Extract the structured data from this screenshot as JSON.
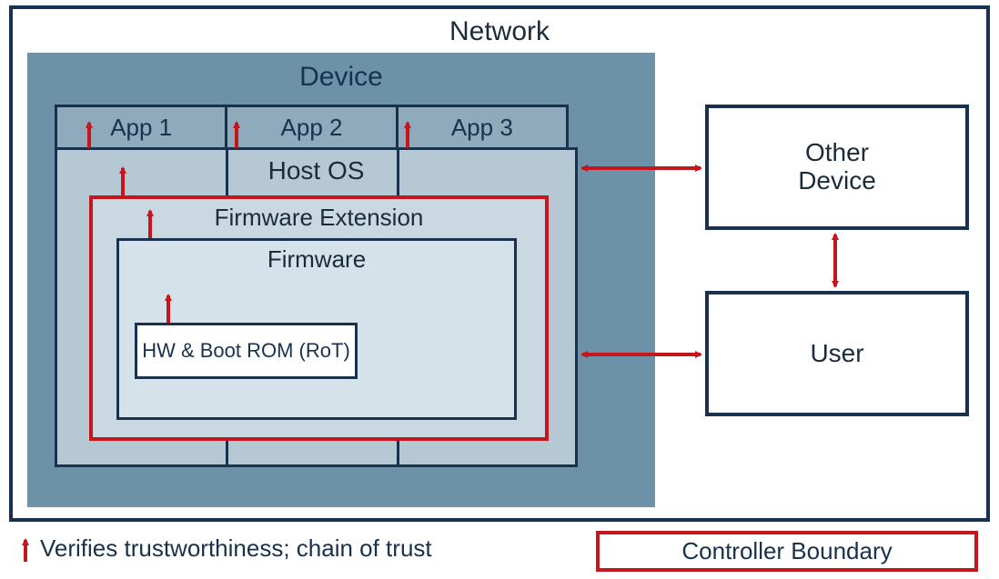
{
  "network": {
    "label": "Network"
  },
  "device": {
    "label": "Device"
  },
  "apps": [
    "App 1",
    "App 2",
    "App 3"
  ],
  "hostos": {
    "label": "Host OS"
  },
  "fwext": {
    "label": "Firmware Extension"
  },
  "fw": {
    "label": "Firmware"
  },
  "rot": {
    "label": "HW & Boot ROM (RoT)"
  },
  "other_device": {
    "label": "Other\nDevice"
  },
  "user": {
    "label": "User"
  },
  "legend": {
    "trust": "Verifies trustworthiness; chain of trust",
    "controller": "Controller Boundary"
  },
  "colors": {
    "navy": "#18314f",
    "red": "#c4161c",
    "device_bg": "#6d92a8"
  }
}
